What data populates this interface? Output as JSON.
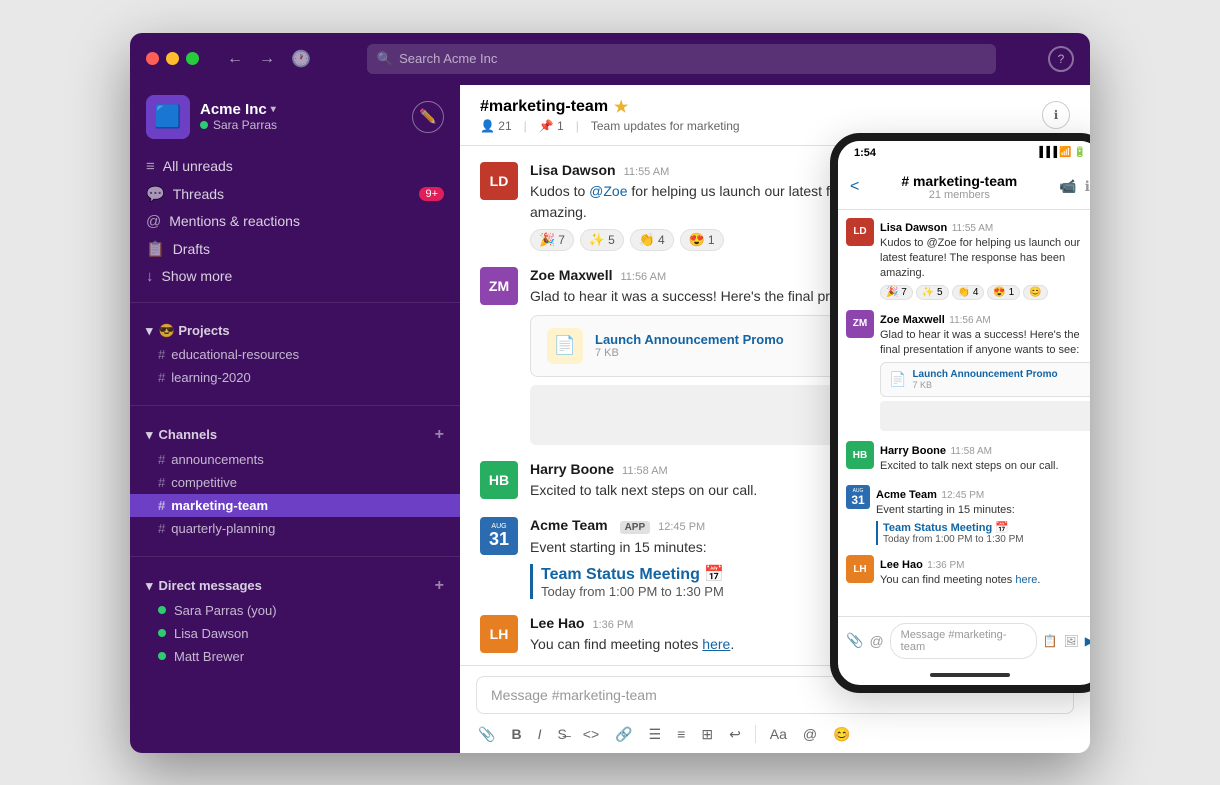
{
  "titlebar": {
    "search_placeholder": "Search Acme Inc",
    "help_label": "?",
    "back_label": "←",
    "forward_label": "→",
    "history_label": "🕐"
  },
  "sidebar": {
    "workspace_name": "Acme Inc",
    "user_name": "Sara Parras",
    "nav": [
      {
        "id": "all-unreads",
        "icon": "≡",
        "label": "All unreads"
      },
      {
        "id": "threads",
        "icon": "💬",
        "label": "Threads",
        "badge": "9+"
      },
      {
        "id": "mentions",
        "icon": "@",
        "label": "Mentions & reactions"
      },
      {
        "id": "drafts",
        "icon": "📋",
        "label": "Drafts"
      },
      {
        "id": "show-more",
        "icon": "↓",
        "label": "Show more"
      }
    ],
    "projects": {
      "label": "😎 Projects",
      "channels": [
        {
          "name": "educational-resources"
        },
        {
          "name": "learning-2020"
        }
      ]
    },
    "channels": {
      "label": "Channels",
      "items": [
        {
          "name": "announcements",
          "active": false
        },
        {
          "name": "competitive",
          "active": false
        },
        {
          "name": "marketing-team",
          "active": true
        },
        {
          "name": "quarterly-planning",
          "active": false
        }
      ]
    },
    "direct_messages": {
      "label": "Direct messages",
      "items": [
        {
          "name": "Sara Parras",
          "you": true,
          "online": true
        },
        {
          "name": "Lisa Dawson",
          "online": true
        },
        {
          "name": "Matt Brewer",
          "online": true
        }
      ]
    }
  },
  "chat": {
    "channel_name": "#marketing-team",
    "channel_star": "★",
    "channel_members": "21",
    "channel_pinned": "1",
    "channel_description": "Team updates for marketing",
    "messages": [
      {
        "id": "msg1",
        "author": "Lisa Dawson",
        "time": "11:55 AM",
        "text_before": "Kudos to ",
        "mention": "@Zoe",
        "text_after": " for helping us launch our latest feature! The response has been amazing.",
        "reactions": [
          {
            "emoji": "🎉",
            "count": "7"
          },
          {
            "emoji": "✨",
            "count": "5"
          },
          {
            "emoji": "👏",
            "count": "4"
          },
          {
            "emoji": "😍",
            "count": "1"
          }
        ]
      },
      {
        "id": "msg2",
        "author": "Zoe Maxwell",
        "time": "11:56 AM",
        "text": "Glad to hear it was a success! Here's the final presentation if anyone wants to see:",
        "attachment_name": "Launch Announcement Promo",
        "attachment_size": "7 KB"
      },
      {
        "id": "msg3",
        "author": "Harry Boone",
        "time": "11:58 AM",
        "text": "Excited to talk next steps on our call."
      },
      {
        "id": "msg4",
        "author": "Acme Team",
        "time": "12:45 PM",
        "app": "APP",
        "text": "Event starting in 15 minutes:",
        "event_name": "Team Status Meeting 📅",
        "event_time": "Today from 1:00 PM to 1:30 PM"
      },
      {
        "id": "msg5",
        "author": "Lee Hao",
        "time": "1:36 PM",
        "text_before": "You can find meeting notes ",
        "link": "here",
        "text_after": "."
      }
    ],
    "message_placeholder": "Message #marketing-team",
    "toolbar_buttons": [
      "📎",
      "B",
      "I",
      "S̶",
      "<>",
      "🔗",
      "☰",
      "☰",
      "⊞",
      "↩️",
      "Aa",
      "@",
      "😊"
    ]
  },
  "mobile": {
    "status_time": "1:54",
    "channel_name": "# marketing-team",
    "member_count": "21 members",
    "back_label": "<",
    "messages": [
      {
        "author": "Lisa Dawson",
        "time": "11:55 AM",
        "text": "Kudos to @Zoe for helping us launch our latest feature! The response has been amazing.",
        "reactions": [
          "🎉 7",
          "✨ 5",
          "👏 4",
          "😍 1",
          "😊"
        ]
      },
      {
        "author": "Zoe Maxwell",
        "time": "11:56 AM",
        "text": "Glad to hear it was a success! Here's the final presentation if anyone wants to see:",
        "has_attachment": true,
        "attachment_name": "Launch Announcement Promo",
        "attachment_size": "7 KB"
      },
      {
        "author": "Harry Boone",
        "time": "11:58 AM",
        "text": "Excited to talk next steps on our call."
      },
      {
        "author": "Acme Team",
        "time": "12:45 PM",
        "text": "Event starting in 15 minutes:",
        "event_name": "Team Status Meeting 📅",
        "event_time": "Today from 1:00 PM to 1:30 PM"
      },
      {
        "author": "Lee Hao",
        "time": "1:36 PM",
        "text": "You can find meeting notes here."
      }
    ],
    "input_placeholder": "Message #marketing-team"
  }
}
